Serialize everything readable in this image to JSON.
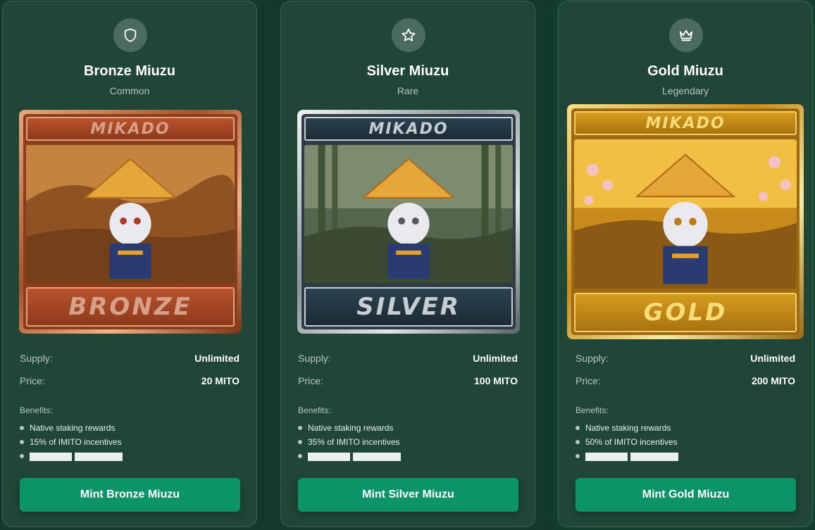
{
  "cards": [
    {
      "icon": "shield-icon",
      "title": "Bronze Miuzu",
      "rarity": "Common",
      "art_header": "MIKADO",
      "art_footer": "BRONZE",
      "supply_label": "Supply:",
      "supply_value": "Unlimited",
      "price_label": "Price:",
      "price_value": "20 MITO",
      "benefits_heading": "Benefits:",
      "benefits": [
        "Native staking rewards",
        "15% of IMITO incentives"
      ],
      "mint_label": "Mint Bronze Miuzu",
      "accent": "#b8532e"
    },
    {
      "icon": "star-icon",
      "title": "Silver Miuzu",
      "rarity": "Rare",
      "art_header": "MIKADO",
      "art_footer": "SILVER",
      "supply_label": "Supply:",
      "supply_value": "Unlimited",
      "price_label": "Price:",
      "price_value": "100 MITO",
      "benefits_heading": "Benefits:",
      "benefits": [
        "Native staking rewards",
        "35% of IMITO incentives"
      ],
      "mint_label": "Mint Silver Miuzu",
      "accent": "#c9d0d4"
    },
    {
      "icon": "crown-icon",
      "title": "Gold Miuzu",
      "rarity": "Legendary",
      "art_header": "MIKADO",
      "art_footer": "GOLD",
      "supply_label": "Supply:",
      "supply_value": "Unlimited",
      "price_label": "Price:",
      "price_value": "200 MITO",
      "benefits_heading": "Benefits:",
      "benefits": [
        "Native staking rewards",
        "50% of IMITO incentives"
      ],
      "mint_label": "Mint Gold Miuzu",
      "accent": "#d49c1e"
    }
  ],
  "colors": {
    "background": "#12392a",
    "card": "#1f4636",
    "button": "#0b9467"
  }
}
